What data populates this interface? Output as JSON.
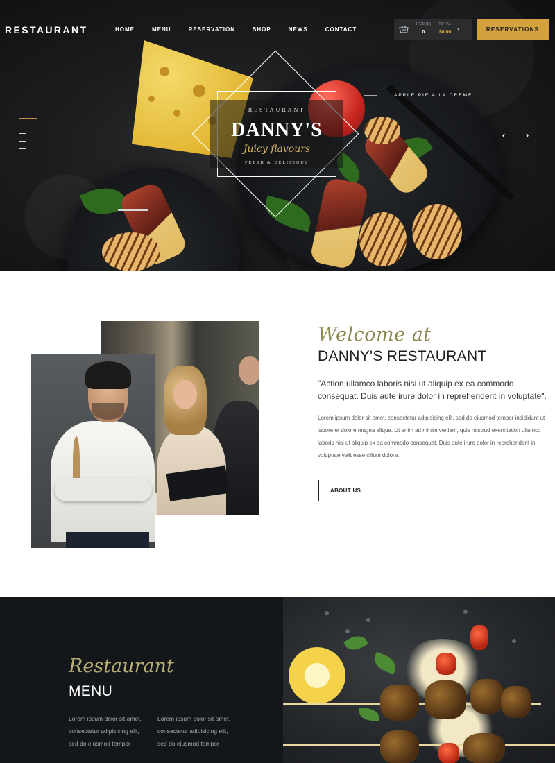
{
  "brand": {
    "logo": "RESTAURANT"
  },
  "nav": {
    "items": [
      {
        "label": "HOME"
      },
      {
        "label": "MENU"
      },
      {
        "label": "RESERVATION"
      },
      {
        "label": "SHOP"
      },
      {
        "label": "NEWS"
      },
      {
        "label": "CONTACT"
      }
    ]
  },
  "cart": {
    "items_label": "ITEM(S)",
    "total_label": "TOTAL",
    "items_value": "0",
    "total_value": "$0.00",
    "icon": "basket-icon"
  },
  "reservations_button": "RESERVATIONS",
  "hero": {
    "badge_pre": "RESTAURANT",
    "badge_name": "DANNY'S",
    "badge_tagline": "Juicy flavours",
    "badge_sub": "FRESH & DELICIOUS",
    "caption": "APPLE PIE A LA CREME",
    "prev_arrow": "‹",
    "next_arrow": "›"
  },
  "welcome": {
    "script": "Welcome at",
    "title": "DANNY'S RESTAURANT",
    "quote": "\"Action ullamco laboris nisi ut aliquip ex ea commodo consequat. Duis aute irure dolor in reprehenderit in voluptate\".",
    "body": "Lorem ipsum dolor sit amet, consectetur adipisicing elit, sed do eiusmod tempor incididunt ut labore et dolore magna aliqua. Ut enim ad minim veniam, quis nostrud exercitation ullamco laboris nisi ut aliquip ex ea commodo consequat. Duis aute irure dolor in reprehenderit in voluptate velit esse cillum dolore.",
    "button": "ABOUT US"
  },
  "menu_section": {
    "script": "Restaurant",
    "title": "MENU",
    "col1": "Lorem ipsum dolor sit amet, consectetur adipisicing elit, sed do eiusmod tempor",
    "col2": "Lorem ipsum dolor sit amet, consectetur adipisicing elit, sed do eiusmod tempor"
  },
  "colors": {
    "accent_gold": "#d4a13f",
    "script_olive": "#8c8750",
    "dark_bg": "#14171a"
  }
}
